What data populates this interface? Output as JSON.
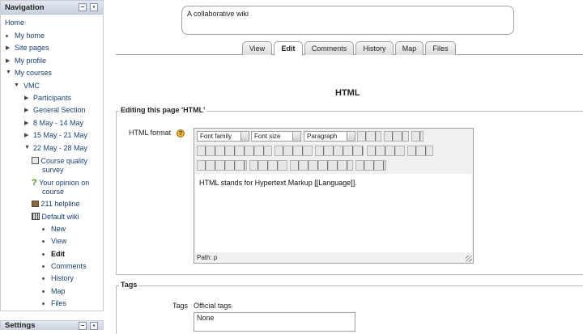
{
  "nav": {
    "title": "Navigation",
    "items": [
      {
        "label": "Home"
      },
      {
        "label": "My home"
      },
      {
        "label": "Site pages"
      },
      {
        "label": "My profile"
      },
      {
        "label": "My courses"
      },
      {
        "label": "VMC"
      },
      {
        "label": "Participants"
      },
      {
        "label": "General Section"
      },
      {
        "label": "8 May - 14 May"
      },
      {
        "label": "15 May - 21 May"
      },
      {
        "label": "22 May - 28 May"
      },
      {
        "label": "Course quality"
      },
      {
        "label": "survey"
      },
      {
        "label": "Your opinion on"
      },
      {
        "label": "course"
      },
      {
        "label": "211 helpline"
      },
      {
        "label": "Default wiki"
      },
      {
        "label": "New"
      },
      {
        "label": "View"
      },
      {
        "label": "Edit"
      },
      {
        "label": "Comments"
      },
      {
        "label": "History"
      },
      {
        "label": "Map"
      },
      {
        "label": "Files"
      }
    ]
  },
  "settings": {
    "title": "Settings"
  },
  "wiki": {
    "name": "A collaborative wiki"
  },
  "tabs": [
    {
      "label": "View"
    },
    {
      "label": "Edit"
    },
    {
      "label": "Comments"
    },
    {
      "label": "History"
    },
    {
      "label": "Map"
    },
    {
      "label": "Files"
    }
  ],
  "page": {
    "heading": "HTML"
  },
  "editing": {
    "legend": "Editing this page 'HTML'",
    "format_label": "HTML format",
    "help_glyph": "?",
    "font_family": "Font family",
    "font_size": "Font size",
    "paragraph": "Paragraph",
    "content": "HTML stands for Hypertext Markup [[Language]].",
    "path": "Path: p"
  },
  "tags": {
    "legend": "Tags",
    "label": "Tags",
    "official": "Official tags",
    "value": "None"
  }
}
